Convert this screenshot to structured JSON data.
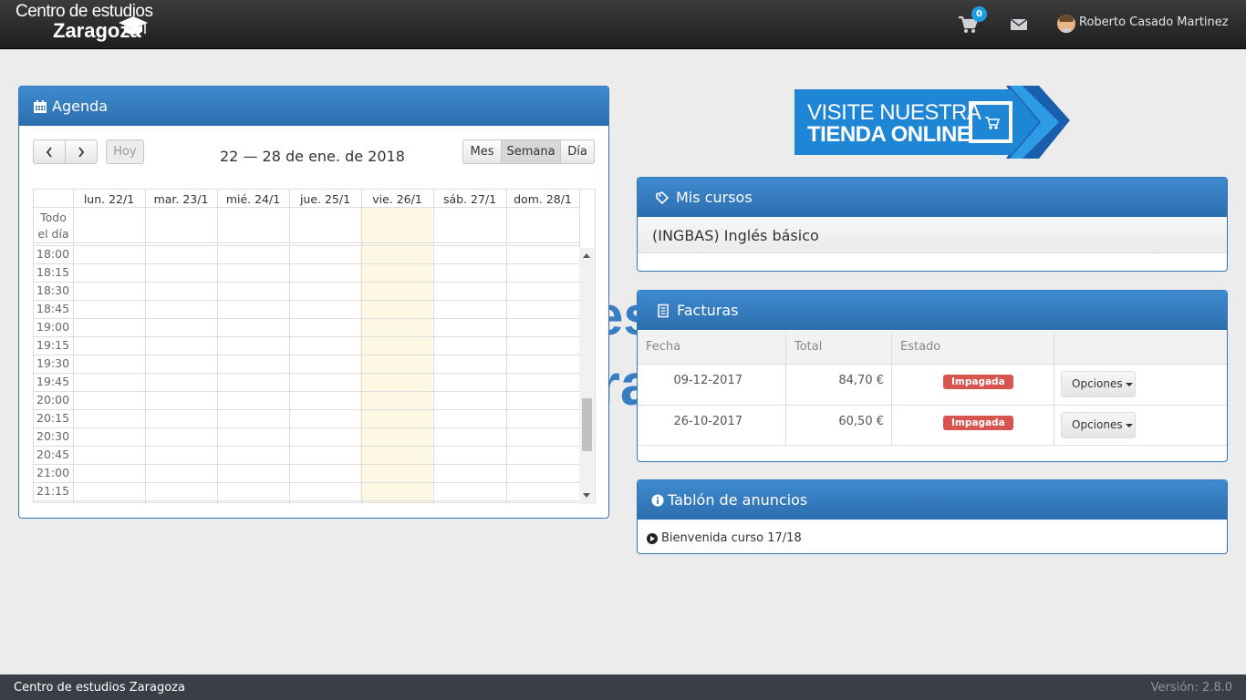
{
  "brand": {
    "line1": "Centro de estudios",
    "line2": "Zaragoza"
  },
  "navbar": {
    "cart_count": "0",
    "user_name": "Roberto Casado Martinez"
  },
  "agenda": {
    "title": "Agenda",
    "today_label": "Hoy",
    "range_title": "22 — 28 de ene. de 2018",
    "views": [
      "Mes",
      "Semana",
      "Día"
    ],
    "active_view": "Semana",
    "days": [
      "lun. 22/1",
      "mar. 23/1",
      "mié. 24/1",
      "jue. 25/1",
      "vie. 26/1",
      "sáb. 27/1",
      "dom. 28/1"
    ],
    "today_day": "vie. 26/1",
    "allday_label": [
      "Todo",
      "el día"
    ],
    "times": [
      "18:00",
      "18:15",
      "18:30",
      "18:45",
      "19:00",
      "19:15",
      "19:30",
      "19:45",
      "20:00",
      "20:15",
      "20:30",
      "20:45",
      "21:00",
      "21:15"
    ]
  },
  "banner": {
    "line1": "VISITE NUESTRA",
    "line2": "TIENDA ONLINE"
  },
  "cursos": {
    "title": "Mis cursos",
    "items": [
      "(INGBAS) Inglés básico"
    ]
  },
  "facturas": {
    "title": "Facturas",
    "headers": [
      "Fecha",
      "Total",
      "Estado"
    ],
    "rows": [
      {
        "fecha": "09-12-2017",
        "total": "84,70 €",
        "estado": "Impagada",
        "options": "Opciones"
      },
      {
        "fecha": "26-10-2017",
        "total": "60,50 €",
        "estado": "Impagada",
        "options": "Opciones"
      }
    ]
  },
  "tablon": {
    "title": "Tablón de anuncios",
    "items": [
      "Bienvenida curso 17/18"
    ]
  },
  "footer": {
    "left": "Centro de estudios Zaragoza",
    "right": "Versión: 2.8.0"
  },
  "colors": {
    "primary": "#2f77b8",
    "danger": "#d9534f",
    "today": "#fcf8e3",
    "badge": "#1e9ee0"
  }
}
